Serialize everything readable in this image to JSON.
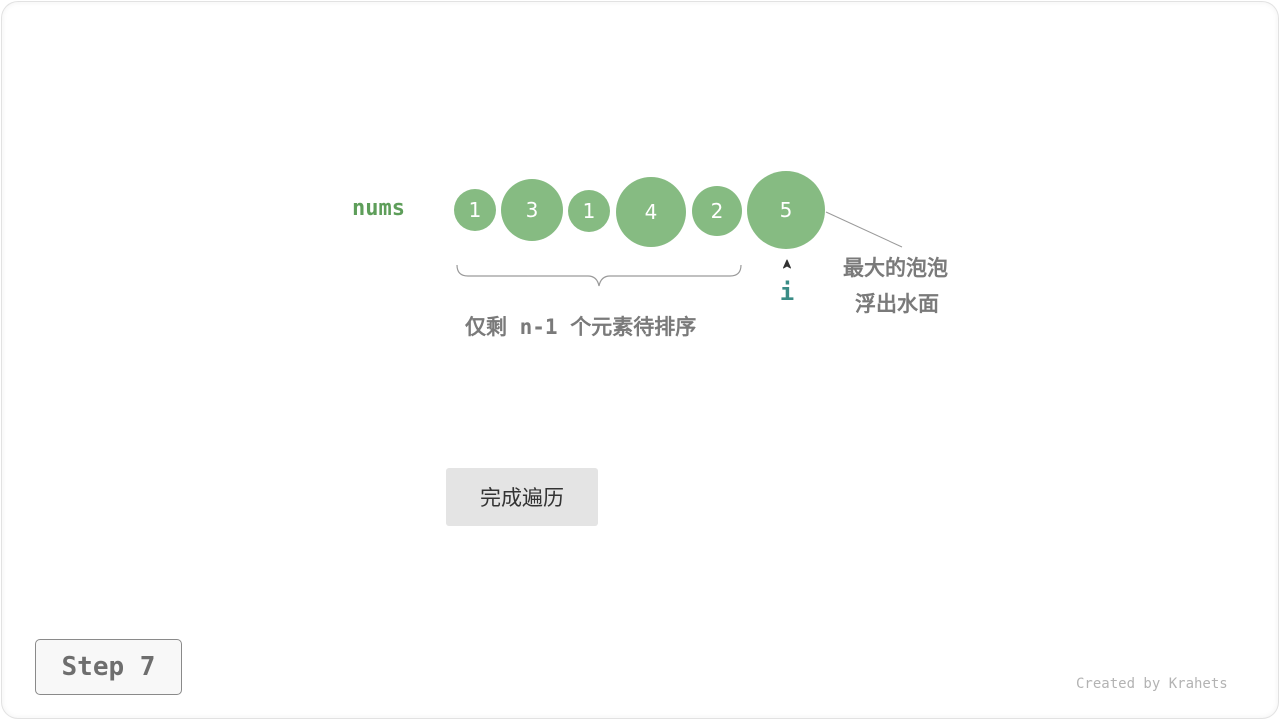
{
  "array": {
    "label": "nums",
    "values": [
      1,
      3,
      1,
      4,
      2,
      5
    ],
    "bubble_color": "#86bb82",
    "label_color": "#5e9e5a"
  },
  "annotations": {
    "remaining": "仅剩 n-1 个元素待排序",
    "bubble_line1": "最大的泡泡",
    "bubble_line2": "浮出水面",
    "pointer": "i",
    "pointer_color": "#3a8c86"
  },
  "button": {
    "label": "完成遍历"
  },
  "step": {
    "label": "Step 7"
  },
  "credit": "Created by Krahets"
}
